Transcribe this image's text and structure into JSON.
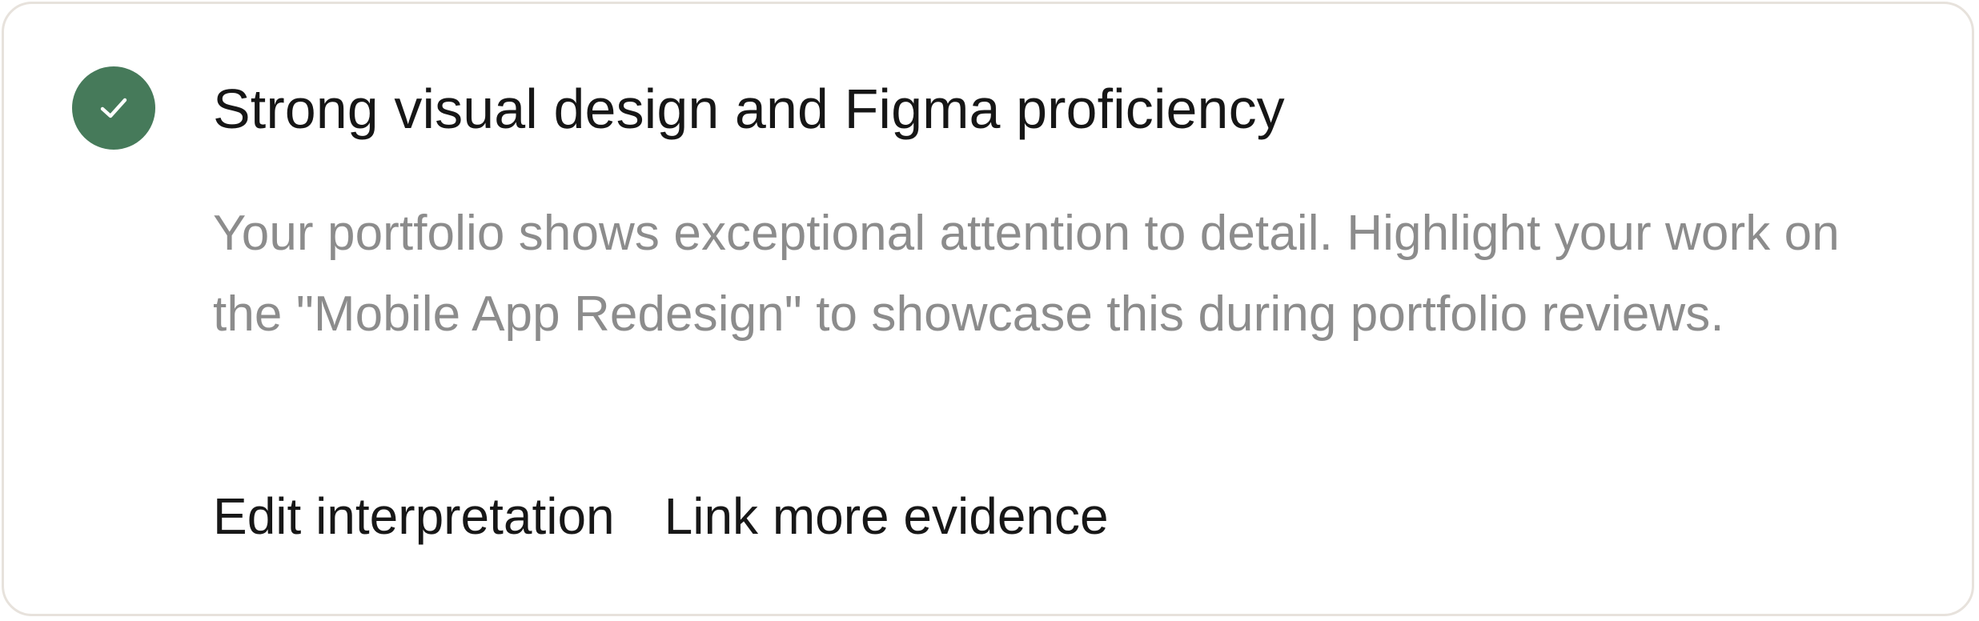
{
  "card": {
    "status_icon": "checkmark-icon",
    "status_color": "#467a5a",
    "title": "Strong visual design and Figma proficiency",
    "description": "Your portfolio shows exceptional attention to detail. Highlight your work on the \"Mobile App Redesign\" to showcase this during portfolio reviews.",
    "actions": {
      "edit_label": "Edit interpretation",
      "link_label": "Link more evidence"
    }
  }
}
